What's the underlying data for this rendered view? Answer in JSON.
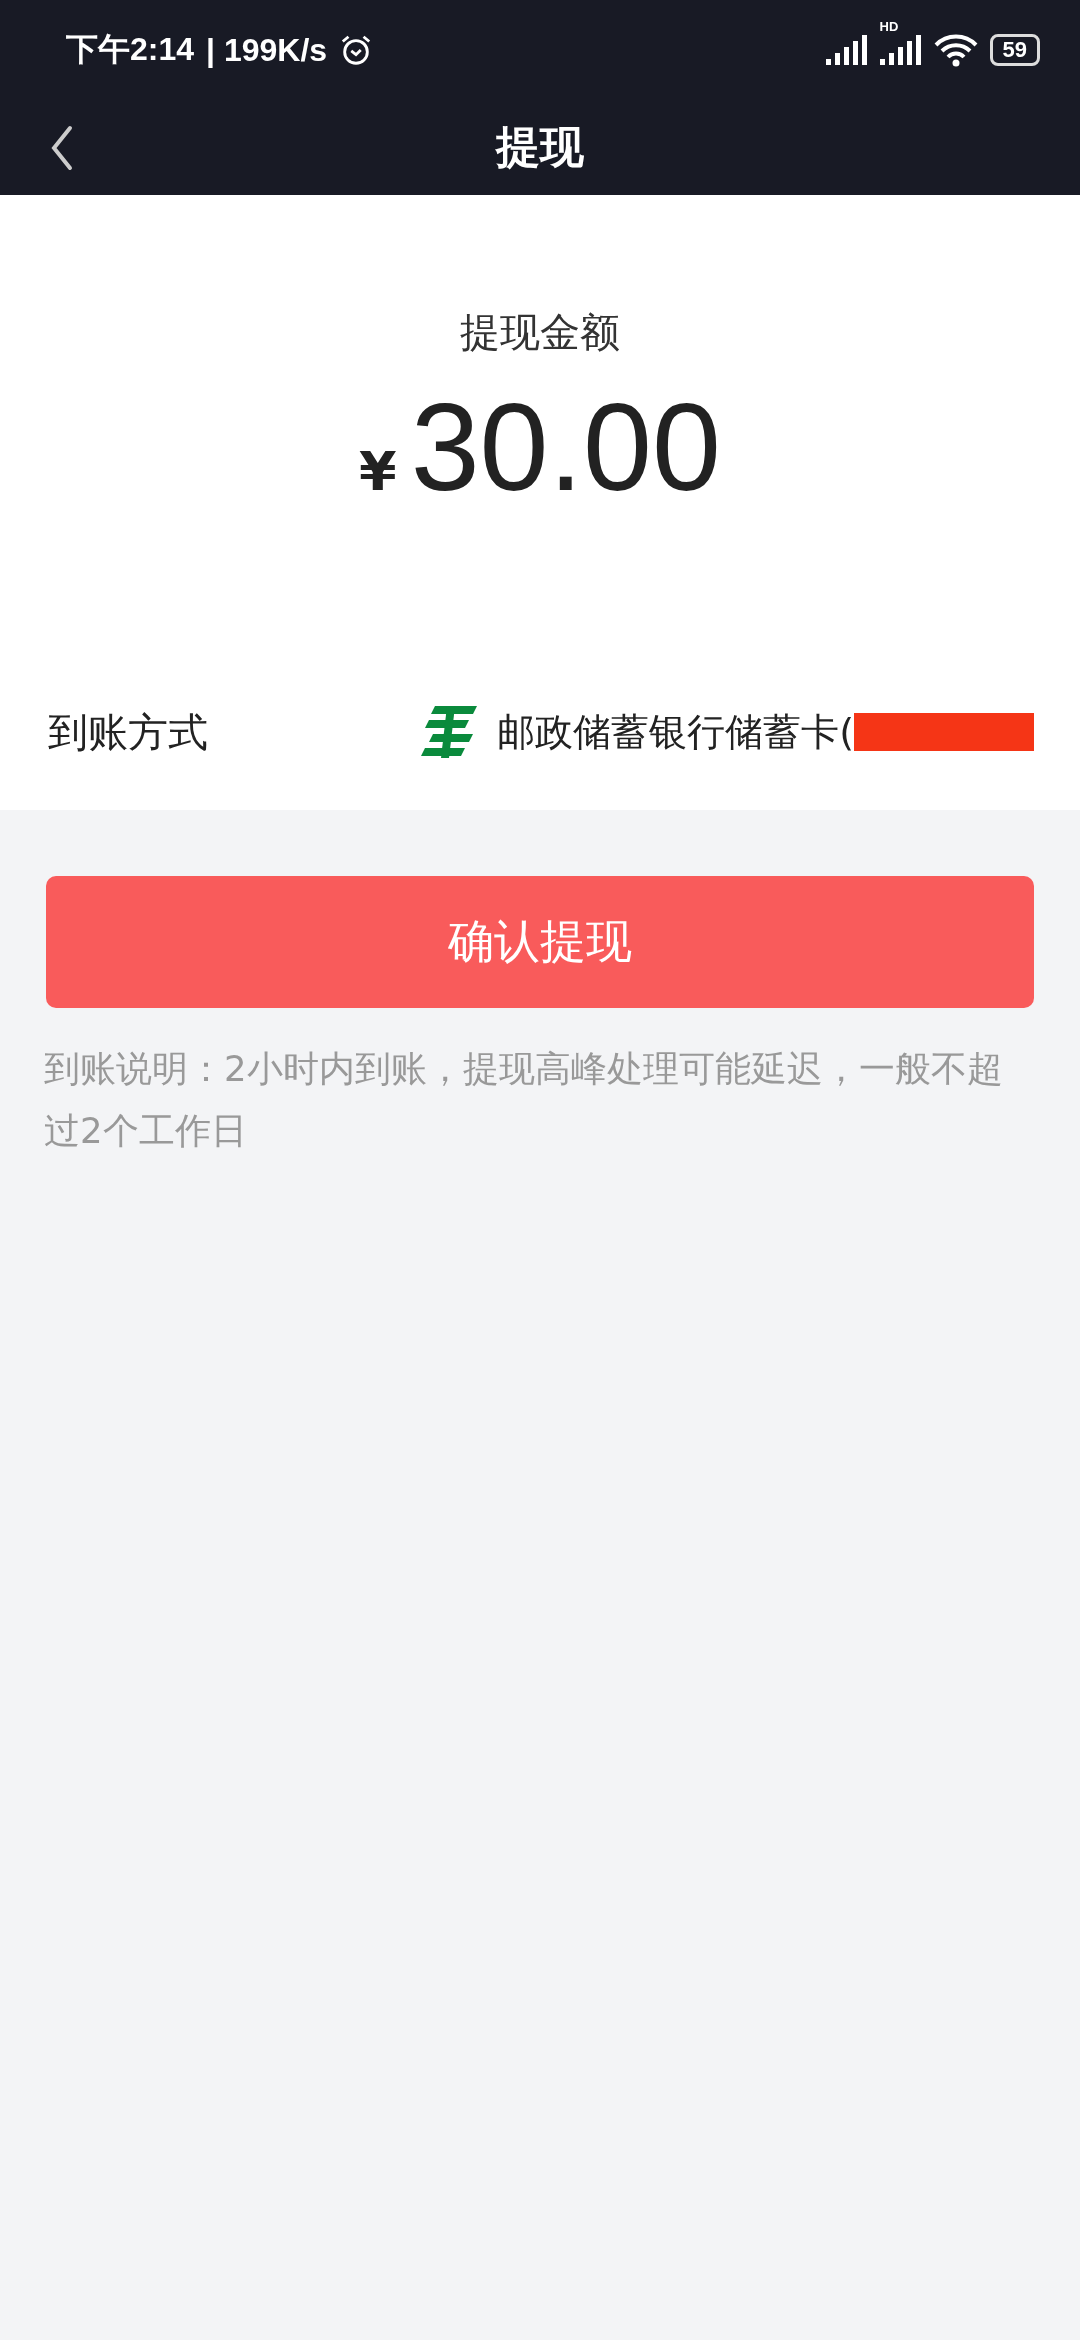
{
  "status_bar": {
    "time": "下午2:14",
    "speed": "| 199K/s",
    "network_label": "HD",
    "battery": "59"
  },
  "nav": {
    "title": "提现"
  },
  "amount": {
    "label": "提现金额",
    "currency": "¥",
    "value": "30.00"
  },
  "method": {
    "label": "到账方式",
    "bank": "邮政储蓄银行储蓄卡(",
    "redacted": true
  },
  "confirm_button": "确认提现",
  "note": "到账说明：2小时内到账，提现高峰处理可能延迟，一般不超过2个工作日"
}
